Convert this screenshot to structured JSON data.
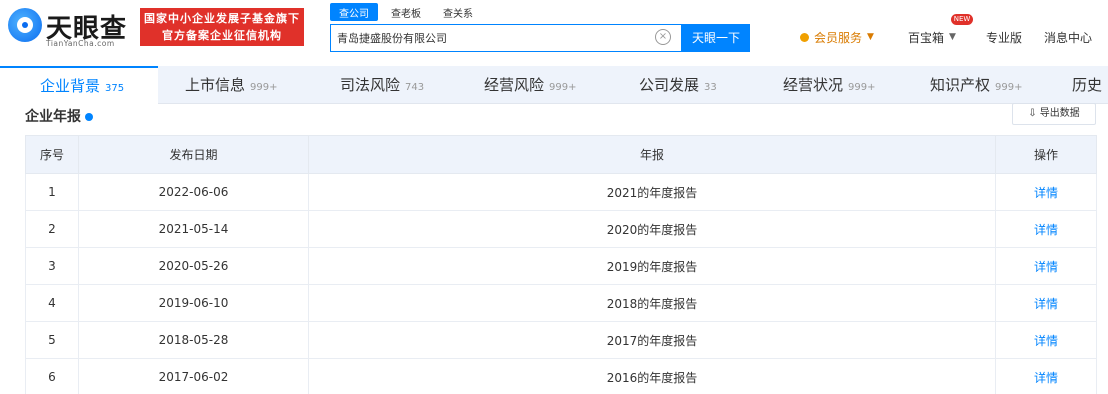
{
  "logo": {
    "name": "天眼查",
    "sub": "TianYanCha.com"
  },
  "promo": {
    "line1": "国家中小企业发展子基金旗下",
    "line2": "官方备案企业征信机构"
  },
  "search": {
    "tabs": [
      "查公司",
      "查老板",
      "查关系"
    ],
    "value": "青岛捷盛股份有限公司",
    "button": "天眼一下"
  },
  "nav": {
    "vip": "会员服务",
    "hundred": "百宝箱",
    "hundred_badge": "NEW",
    "pro": "专业版",
    "msg": "消息中心"
  },
  "tabs": [
    {
      "label": "企业背景",
      "count": "375"
    },
    {
      "label": "上市信息",
      "count": "999+"
    },
    {
      "label": "司法风险",
      "count": "743"
    },
    {
      "label": "经营风险",
      "count": "999+"
    },
    {
      "label": "公司发展",
      "count": "33"
    },
    {
      "label": "经营状况",
      "count": "999+"
    },
    {
      "label": "知识产权",
      "count": "999+"
    },
    {
      "label": "历史",
      "count": ""
    }
  ],
  "section": {
    "title": "企业年报",
    "export": "导出数据"
  },
  "table": {
    "headers": [
      "序号",
      "发布日期",
      "年报",
      "操作"
    ],
    "rows": [
      {
        "no": "1",
        "date": "2022-06-06",
        "report": "2021的年度报告",
        "action": "详情"
      },
      {
        "no": "2",
        "date": "2021-05-14",
        "report": "2020的年度报告",
        "action": "详情"
      },
      {
        "no": "3",
        "date": "2020-05-26",
        "report": "2019的年度报告",
        "action": "详情"
      },
      {
        "no": "4",
        "date": "2019-06-10",
        "report": "2018的年度报告",
        "action": "详情"
      },
      {
        "no": "5",
        "date": "2018-05-28",
        "report": "2017的年度报告",
        "action": "详情"
      },
      {
        "no": "6",
        "date": "2017-06-02",
        "report": "2016的年度报告",
        "action": "详情"
      }
    ]
  },
  "colors": {
    "accent": "#0084ff",
    "promo": "#e0312a",
    "vip": "#d97b00"
  }
}
